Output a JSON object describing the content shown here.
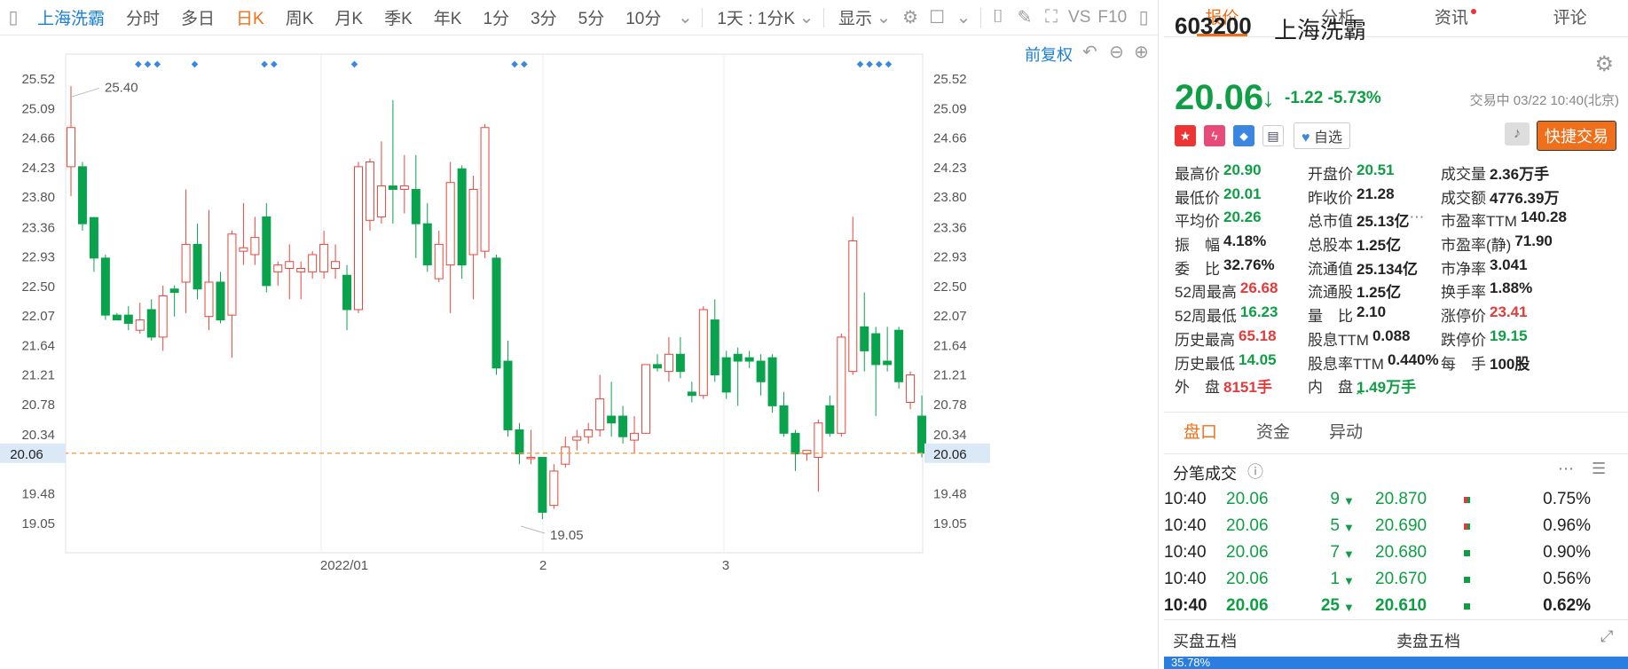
{
  "toolbar": {
    "stock": "上海洗霸",
    "tabs": [
      "分时",
      "多日",
      "日K",
      "周K",
      "月K",
      "季K",
      "年K",
      "1分",
      "3分",
      "5分",
      "10分"
    ],
    "active_tab": "日K",
    "combo": "1天 : 1分K",
    "display": "显示",
    "vs": "VS",
    "f10": "F10"
  },
  "chart": {
    "restore_label": "前复权",
    "y_ticks": [
      "25.52",
      "25.09",
      "24.66",
      "24.23",
      "23.80",
      "23.36",
      "22.93",
      "22.50",
      "22.07",
      "21.64",
      "21.21",
      "20.78",
      "20.34",
      "19.91",
      "19.48",
      "19.05"
    ],
    "x_labels": [
      "2022/01",
      "2",
      "3"
    ],
    "current_price": "20.06",
    "max_label": "25.40",
    "min_label": "19.05"
  },
  "chart_data": {
    "type": "candlestick",
    "ylim": [
      18.7,
      25.75
    ],
    "current": 20.06,
    "candles": [
      [
        24.23,
        24.8,
        23.8,
        25.4
      ],
      [
        24.23,
        23.4,
        23.3,
        24.3
      ],
      [
        23.49,
        22.9,
        22.7,
        23.5
      ],
      [
        22.9,
        22.07,
        22.0,
        22.95
      ],
      [
        22.07,
        22.0,
        22.0,
        22.1
      ],
      [
        22.07,
        21.95,
        21.85,
        22.2
      ],
      [
        21.85,
        22.0,
        21.8,
        22.25
      ],
      [
        22.15,
        21.75,
        21.7,
        22.3
      ],
      [
        21.75,
        22.35,
        21.55,
        22.5
      ],
      [
        22.45,
        22.4,
        22.05,
        22.5
      ],
      [
        22.55,
        23.1,
        22.1,
        23.9
      ],
      [
        23.1,
        22.45,
        22.3,
        23.4
      ],
      [
        22.05,
        22.55,
        21.85,
        23.6
      ],
      [
        22.55,
        22.0,
        21.95,
        22.7
      ],
      [
        22.07,
        23.25,
        21.45,
        23.3
      ],
      [
        23.0,
        23.05,
        22.8,
        23.7
      ],
      [
        22.95,
        23.2,
        22.8,
        23.5
      ],
      [
        23.5,
        22.5,
        22.4,
        23.7
      ],
      [
        22.7,
        22.8,
        22.5,
        22.85
      ],
      [
        22.75,
        22.85,
        22.3,
        23.1
      ],
      [
        22.7,
        22.75,
        22.3,
        22.85
      ],
      [
        22.7,
        22.95,
        22.6,
        23.0
      ],
      [
        22.7,
        23.1,
        22.6,
        23.3
      ],
      [
        22.75,
        22.85,
        22.6,
        23.1
      ],
      [
        22.65,
        22.15,
        21.85,
        22.8
      ],
      [
        22.15,
        24.23,
        22.1,
        24.3
      ],
      [
        23.45,
        24.3,
        23.3,
        24.35
      ],
      [
        23.5,
        23.95,
        23.4,
        24.6
      ],
      [
        23.95,
        23.9,
        23.4,
        25.2
      ],
      [
        23.9,
        23.95,
        23.55,
        24.4
      ],
      [
        23.9,
        23.4,
        22.9,
        24.4
      ],
      [
        23.4,
        22.8,
        22.7,
        23.7
      ],
      [
        22.6,
        23.1,
        22.55,
        23.3
      ],
      [
        22.8,
        24.0,
        22.1,
        24.3
      ],
      [
        24.2,
        22.8,
        22.6,
        24.25
      ],
      [
        22.95,
        23.9,
        22.3,
        24.1
      ],
      [
        23.0,
        24.8,
        22.9,
        24.85
      ],
      [
        22.9,
        21.3,
        21.2,
        22.95
      ],
      [
        21.4,
        20.4,
        20.3,
        21.7
      ],
      [
        20.4,
        20.05,
        19.9,
        20.5
      ],
      [
        20.0,
        20.0,
        19.9,
        20.4
      ],
      [
        20.0,
        19.2,
        19.1,
        20.0
      ],
      [
        19.3,
        19.8,
        19.25,
        19.9
      ],
      [
        19.9,
        20.15,
        19.85,
        20.3
      ],
      [
        20.25,
        20.3,
        20.1,
        20.4
      ],
      [
        20.3,
        20.4,
        20.2,
        20.5
      ],
      [
        20.4,
        20.85,
        20.3,
        21.2
      ],
      [
        20.6,
        20.5,
        20.3,
        21.1
      ],
      [
        20.6,
        20.3,
        20.2,
        20.75
      ],
      [
        20.25,
        20.35,
        20.05,
        20.6
      ],
      [
        20.35,
        21.35,
        20.35,
        21.35
      ],
      [
        21.35,
        21.3,
        21.25,
        21.5
      ],
      [
        21.25,
        21.5,
        21.1,
        21.75
      ],
      [
        21.5,
        21.25,
        21.15,
        21.75
      ],
      [
        20.95,
        20.9,
        20.8,
        21.1
      ],
      [
        20.9,
        22.15,
        20.85,
        22.2
      ],
      [
        22.0,
        21.2,
        21.1,
        22.3
      ],
      [
        21.45,
        20.95,
        20.85,
        21.55
      ],
      [
        21.5,
        21.4,
        20.75,
        21.6
      ],
      [
        21.45,
        21.4,
        21.3,
        21.55
      ],
      [
        21.4,
        21.1,
        20.9,
        21.5
      ],
      [
        21.45,
        20.75,
        20.65,
        21.5
      ],
      [
        20.75,
        20.35,
        20.3,
        20.95
      ],
      [
        20.35,
        20.05,
        19.8,
        20.4
      ],
      [
        20.05,
        20.1,
        19.95,
        20.1
      ],
      [
        20.0,
        20.5,
        19.5,
        20.55
      ],
      [
        20.75,
        20.35,
        20.3,
        20.9
      ],
      [
        20.35,
        21.75,
        20.3,
        21.8
      ],
      [
        21.25,
        23.15,
        21.2,
        23.5
      ],
      [
        21.9,
        21.55,
        21.25,
        22.4
      ],
      [
        21.8,
        21.35,
        20.6,
        21.9
      ],
      [
        21.4,
        21.35,
        21.25,
        21.9
      ],
      [
        21.85,
        21.1,
        21.0,
        21.9
      ],
      [
        20.8,
        21.2,
        20.7,
        21.25
      ],
      [
        20.6,
        20.06,
        20.0,
        20.9
      ]
    ]
  },
  "dots": [
    "◆◆◆",
    "◆",
    "◆◆",
    "◆",
    "◆◆",
    "◆◆◆◆"
  ],
  "right": {
    "tabs": [
      "报价",
      "分析",
      "资讯",
      "评论"
    ],
    "active_tab": "报价",
    "code": "603200",
    "name": "上海洗霸",
    "price": "20.06",
    "change": "-1.22",
    "change_pct": "-5.73%",
    "status": "交易中 03/22 10:40(北京)",
    "watch_label": "自选",
    "trade_label": "快捷交易",
    "quote": [
      [
        [
          "最高价",
          "20.90",
          "green"
        ],
        [
          "最低价",
          "20.01",
          "green"
        ],
        [
          "平均价",
          "20.26",
          "green"
        ],
        [
          "振　幅",
          "4.18%",
          "dark"
        ],
        [
          "委　比",
          "32.76%",
          "dark"
        ],
        [
          "52周最高",
          "26.68",
          "red"
        ],
        [
          "52周最低",
          "16.23",
          "green"
        ],
        [
          "历史最高",
          "65.18",
          "red"
        ],
        [
          "历史最低",
          "14.05",
          "green"
        ],
        [
          "外　盘",
          "8151手",
          "red"
        ]
      ],
      [
        [
          "开盘价",
          "20.51",
          "green"
        ],
        [
          "昨收价",
          "21.28",
          "dark"
        ],
        [
          "总市值",
          "25.13亿",
          "dark"
        ],
        [
          "总股本",
          "1.25亿",
          "dark"
        ],
        [
          "流通值",
          "25.134亿",
          "dark"
        ],
        [
          "流通股",
          "1.25亿",
          "dark"
        ],
        [
          "量　比",
          "2.10",
          "dark"
        ],
        [
          "股息TTM",
          "0.088",
          "dark"
        ],
        [
          "股息率TTM",
          "0.440%",
          "dark"
        ],
        [
          "内　盘",
          "1.49万手",
          "green"
        ]
      ],
      [
        [
          "成交量",
          "2.36万手",
          "dark"
        ],
        [
          "成交额",
          "4776.39万",
          "dark"
        ],
        [
          "市盈率TTM",
          "140.28",
          "dark"
        ],
        [
          "市盈率(静)",
          "71.90",
          "dark"
        ],
        [
          "市净率",
          "3.041",
          "dark"
        ],
        [
          "换手率",
          "1.88%",
          "dark"
        ],
        [
          "涨停价",
          "23.41",
          "red"
        ],
        [
          "跌停价",
          "19.15",
          "green"
        ],
        [
          "每　手",
          "100股",
          "dark"
        ],
        [
          "",
          ""
        ]
      ]
    ],
    "subtabs": [
      "盘口",
      "资金",
      "异动"
    ],
    "active_subtab": "盘口",
    "tick_title": "分笔成交",
    "ticks": [
      [
        "10:40",
        "20.06",
        "9",
        "20.870",
        "0.75%"
      ],
      [
        "10:40",
        "20.06",
        "5",
        "20.690",
        "0.96%"
      ],
      [
        "10:40",
        "20.06",
        "7",
        "20.680",
        "0.90%"
      ],
      [
        "10:40",
        "20.06",
        "1",
        "20.670",
        "0.56%"
      ],
      [
        "10:40",
        "20.06",
        "25",
        "20.610",
        "0.62%"
      ]
    ],
    "buy5": "买盘五档",
    "sell5": "卖盘五档",
    "bar_text": "35.78%"
  }
}
